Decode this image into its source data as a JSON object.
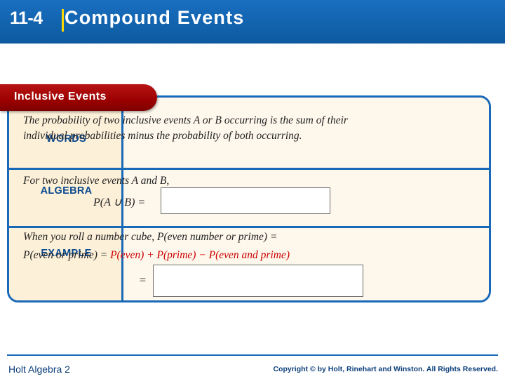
{
  "header": {
    "lesson_number": "11-4",
    "title": "Compound Events"
  },
  "ribbon": {
    "label": "Inclusive Events"
  },
  "table": {
    "rows": [
      {
        "label": "WORDS",
        "text": "The probability of two inclusive events A or B occurring is the sum of their individual probabilities minus the probability of both occurring."
      },
      {
        "label": "ALGEBRA",
        "text": "For two inclusive events A and B,",
        "formula": "P(A ∪ B) =",
        "answer": ""
      },
      {
        "label": "EXAMPLE",
        "line1": "When you roll a number cube, P(even number or prime) =",
        "line2_black_1": "P(even or prime) =",
        "line2_red_1": "P(even) + P(prime) − P(even and prime)",
        "eq_sign": "=",
        "answer": ""
      }
    ]
  },
  "footer": {
    "left": "Holt Algebra 2",
    "right": "Copyright © by Holt, Rinehart and Winston. All Rights Reserved."
  }
}
